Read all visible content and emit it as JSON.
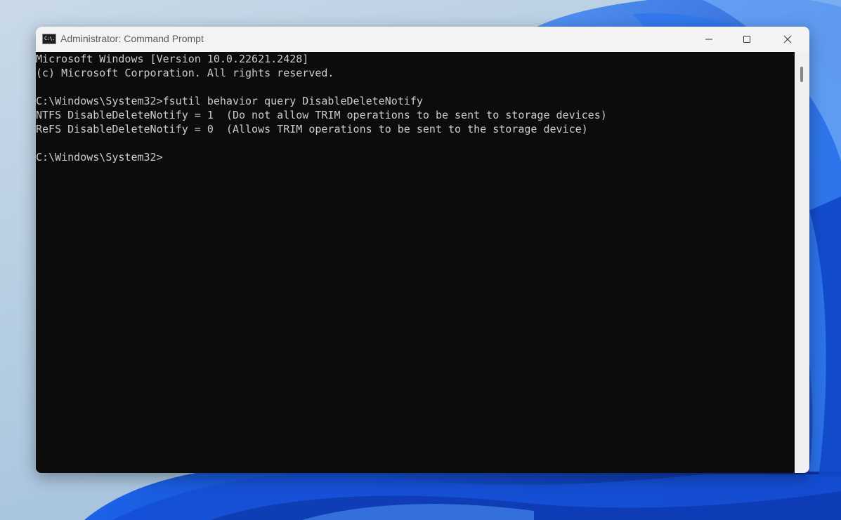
{
  "window": {
    "title": "Administrator: Command Prompt",
    "icon": "cmd-icon",
    "icon_text": "C:\\.",
    "controls": [
      "minimize-icon",
      "maximize-icon",
      "close-icon"
    ]
  },
  "terminal": {
    "lines": [
      "Microsoft Windows [Version 10.0.22621.2428]",
      "(c) Microsoft Corporation. All rights reserved.",
      "",
      "C:\\Windows\\System32>fsutil behavior query DisableDeleteNotify",
      "NTFS DisableDeleteNotify = 1  (Do not allow TRIM operations to be sent to storage devices)",
      "ReFS DisableDeleteNotify = 0  (Allows TRIM operations to be sent to the storage device)",
      "",
      "C:\\Windows\\System32>"
    ],
    "text_color": "#cccccc",
    "background_color": "#0c0c0c"
  },
  "colors": {
    "titlebar": "#f3f3f3",
    "desktop_accent": "#1a5fe0"
  }
}
